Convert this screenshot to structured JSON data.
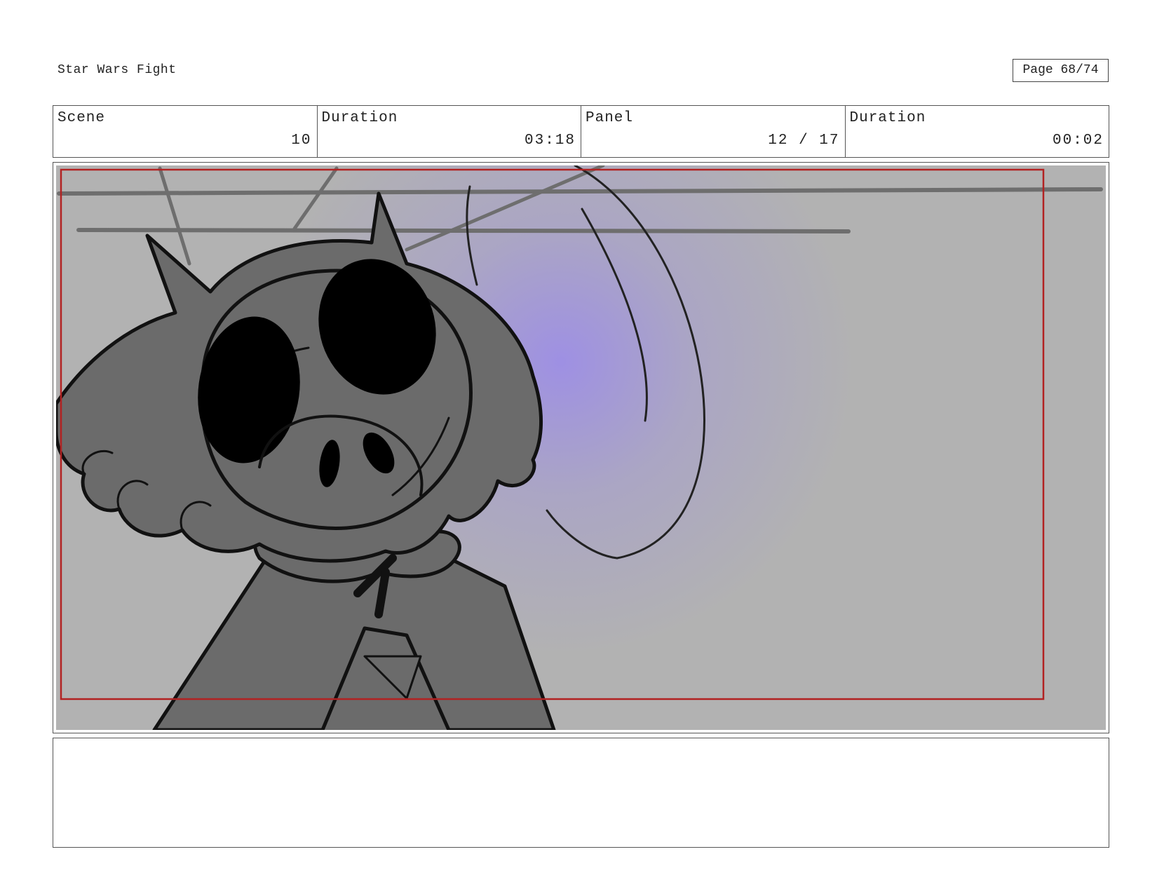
{
  "header": {
    "title": "Star Wars Fight",
    "page_label": "Page 68/74"
  },
  "info": {
    "scene_label": "Scene",
    "scene_value": "10",
    "scene_duration_label": "Duration",
    "scene_duration_value": "03:18",
    "panel_label": "Panel",
    "panel_value": "12 / 17",
    "panel_duration_label": "Duration",
    "panel_duration_value": "00:02"
  },
  "panel": {
    "background_color": "#b2b2b2",
    "glow_color": "#9d8ee6",
    "safe_frame_color": "#b22222",
    "character_fill": "#6b6b6b"
  },
  "notes": {
    "text": ""
  }
}
